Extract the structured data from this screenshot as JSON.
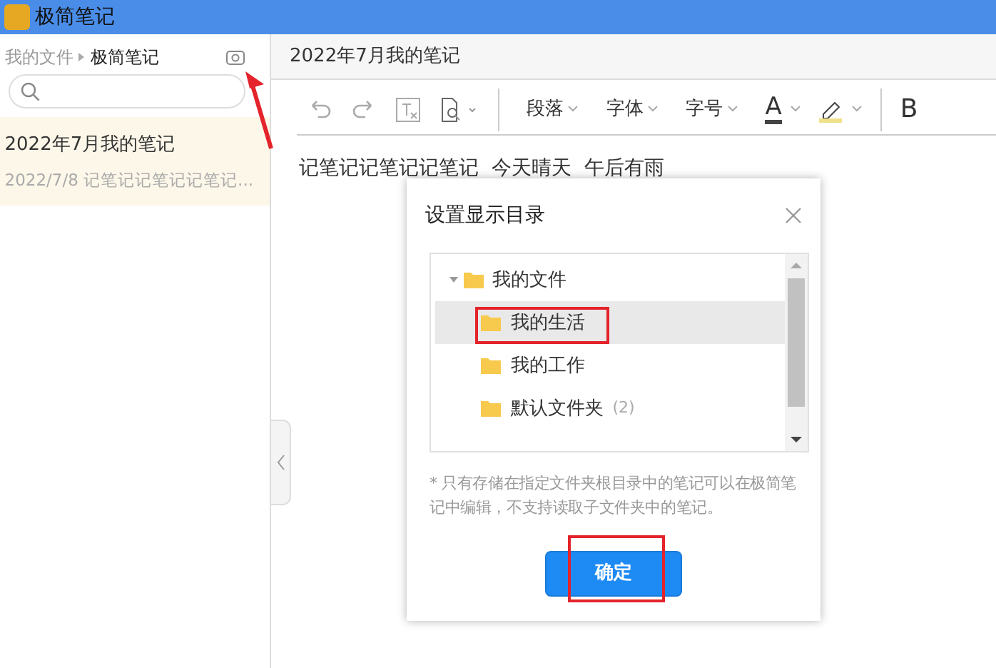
{
  "window": {
    "title": "极简笔记"
  },
  "sidebar": {
    "breadcrumb": [
      "我的文件",
      "极简笔记"
    ],
    "notes": [
      {
        "title": "2022年7月我的笔记",
        "preview": "2022/7/8 记笔记记笔记记笔记...",
        "selected": true
      }
    ]
  },
  "editor": {
    "title": "2022年7月我的笔记",
    "menus": [
      "段落",
      "字体",
      "字号"
    ],
    "font_color": "A",
    "bold": "B",
    "body": "记笔记记笔记记笔记  今天晴天  午后有雨"
  },
  "dialog": {
    "title": "设置显示目录",
    "tree": [
      {
        "label": "我的文件",
        "expanded": true,
        "selected": false,
        "children": [
          {
            "label": "我的生活",
            "selected": true
          },
          {
            "label": "我的工作",
            "selected": false
          },
          {
            "label": "默认文件夹",
            "count": "(2)",
            "selected": false
          }
        ]
      }
    ],
    "note": "* 只有存储在指定文件夹根目录中的笔记可以在极简笔记中编辑，不支持读取子文件夹中的笔记。",
    "confirm": "确定"
  }
}
